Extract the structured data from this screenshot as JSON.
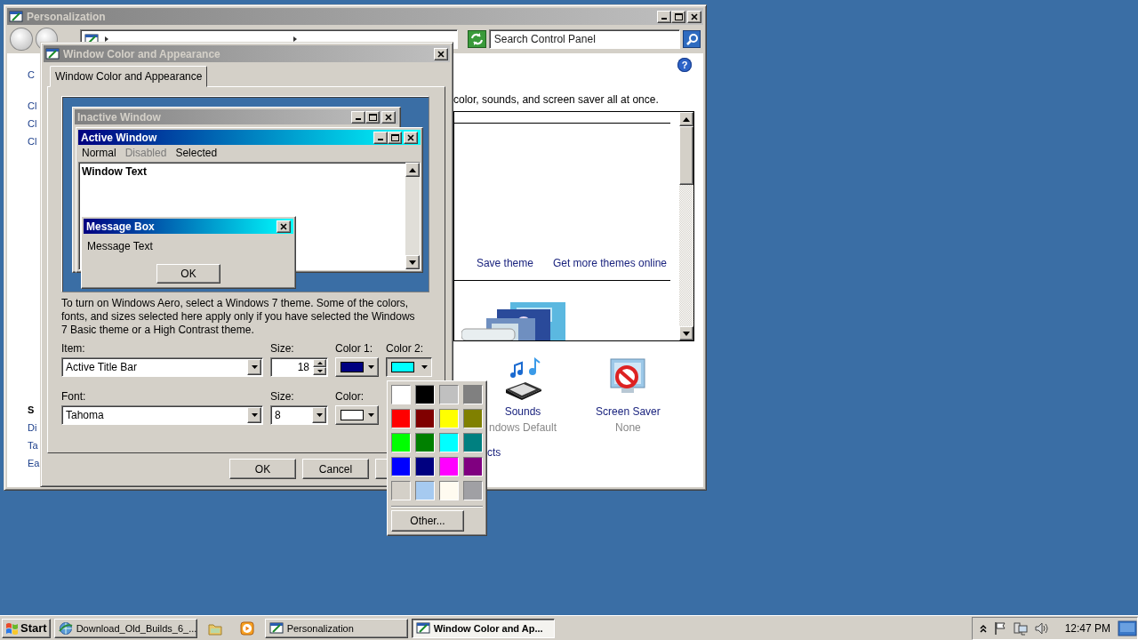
{
  "personalization_window": {
    "title": "Personalization",
    "search": {
      "placeholder": "Search Control Panel"
    },
    "help": "?",
    "left_links_top": [
      "C",
      "Cl",
      "Cl",
      "Cl"
    ],
    "left_links_bottom": [
      "S",
      "Di",
      "Ta",
      "Ea"
    ],
    "description": "color, sounds, and screen saver all at once.",
    "theme_links": [
      "Save theme",
      "Get more themes online"
    ],
    "settings": [
      {
        "kind": "sounds",
        "label": "Sounds",
        "value": "ndows Default"
      },
      {
        "kind": "screensaver",
        "label": "Screen Saver",
        "value": "None"
      }
    ],
    "bottom_link": "cts"
  },
  "dialog": {
    "title": "Window Color and Appearance",
    "tabs": [
      {
        "label": "Window Color and Appearance",
        "selected": true
      }
    ],
    "preview": {
      "inactive_title": "Inactive Window",
      "active_title": "Active Window",
      "menu": [
        {
          "label": "Normal",
          "disabled": false
        },
        {
          "label": "Disabled",
          "disabled": true
        },
        {
          "label": "Selected",
          "disabled": false
        }
      ],
      "window_text": "Window Text",
      "message_title": "Message Box",
      "message_text": "Message Text",
      "message_button": "OK"
    },
    "note": "To turn on Windows Aero, select a Windows 7 theme.  Some of the colors, fonts, and sizes selected here apply only if you have selected the Windows 7 Basic theme or a High Contrast theme.",
    "item": {
      "label": "Item:",
      "value": "Active Title Bar"
    },
    "item_size": {
      "label": "Size:",
      "value": "18"
    },
    "color1": {
      "label": "Color 1:",
      "color": "#000080"
    },
    "color2": {
      "label": "Color 2:",
      "color": "#00ffff",
      "open": true
    },
    "font": {
      "label": "Font:",
      "value": "Tahoma"
    },
    "font_size": {
      "label": "Size:",
      "value": "8"
    },
    "font_color": {
      "label": "Color:",
      "color": "#ffffff"
    },
    "buttons": [
      "OK",
      "Cancel"
    ]
  },
  "color_menu": {
    "swatches": [
      {
        "color": "#ffffff"
      },
      {
        "color": "#000000"
      },
      {
        "color": "#c0c0c0"
      },
      {
        "color": "#808080"
      },
      {
        "color": "#ff0000"
      },
      {
        "color": "#800000"
      },
      {
        "color": "#ffff00"
      },
      {
        "color": "#808000"
      },
      {
        "color": "#00ff00"
      },
      {
        "color": "#008000"
      },
      {
        "color": "#00ffff"
      },
      {
        "color": "#008080"
      },
      {
        "color": "#0000ff"
      },
      {
        "color": "#000080"
      },
      {
        "color": "#ff00ff"
      },
      {
        "color": "#800080"
      },
      {
        "color": "#d4d0c8"
      },
      {
        "color": "#a6caf0"
      },
      {
        "color": "#fffbf0"
      },
      {
        "color": "#a0a0a4"
      }
    ],
    "other_button": "Other..."
  },
  "taskbar": {
    "start": "Start",
    "items": [
      {
        "kind": "browser",
        "label": "Download_Old_Builds_6_...",
        "selected": false
      },
      {
        "kind": "folder"
      },
      {
        "kind": "player"
      },
      {
        "kind": "window",
        "label": "Personalization",
        "selected": false
      },
      {
        "kind": "window",
        "label": "Window Color and Ap...",
        "selected": true
      }
    ],
    "clock": "12:47 PM"
  }
}
